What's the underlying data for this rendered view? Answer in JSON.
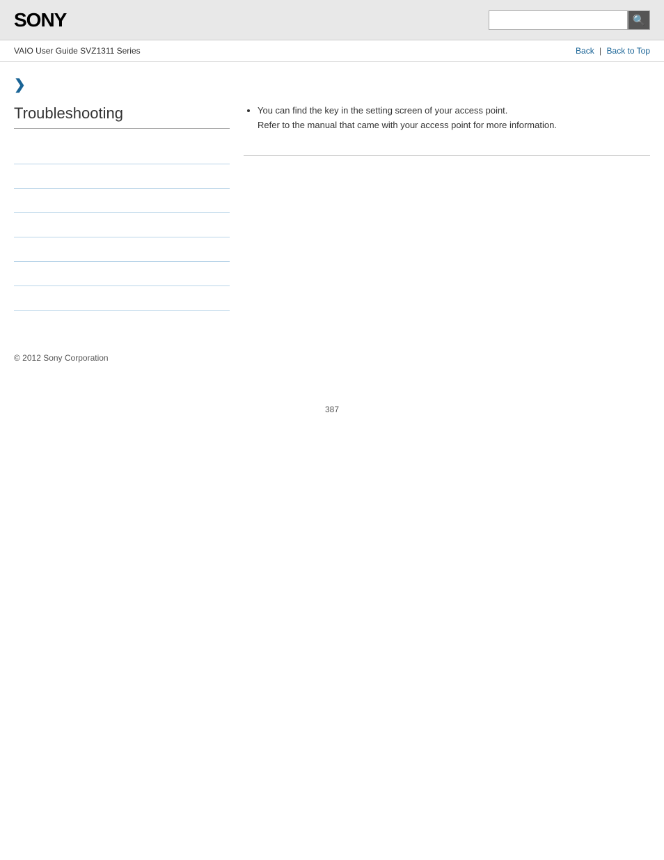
{
  "header": {
    "logo": "SONY",
    "search_placeholder": "",
    "search_icon": "🔍"
  },
  "nav": {
    "breadcrumb": "VAIO User Guide SVZ1311 Series",
    "back_label": "Back",
    "separator": "|",
    "back_to_top_label": "Back to Top"
  },
  "sidebar": {
    "chevron": "❯",
    "title": "Troubleshooting",
    "nav_items": [
      {
        "label": "",
        "href": "#"
      },
      {
        "label": "",
        "href": "#"
      },
      {
        "label": "",
        "href": "#"
      },
      {
        "label": "",
        "href": "#"
      },
      {
        "label": "",
        "href": "#"
      },
      {
        "label": "",
        "href": "#"
      },
      {
        "label": "",
        "href": "#"
      }
    ]
  },
  "content": {
    "bullet_point_1": "You can find the key in the setting screen of your access point.",
    "bullet_point_1_sub": "Refer to the manual that came with your access point for more information."
  },
  "footer": {
    "copyright": "© 2012 Sony Corporation"
  },
  "page": {
    "number": "387"
  }
}
